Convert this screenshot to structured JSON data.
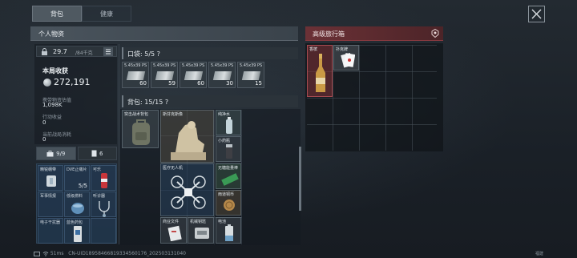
{
  "tabs": [
    {
      "label": "背包",
      "active": true
    },
    {
      "label": "健康",
      "active": false
    }
  ],
  "left_panel": {
    "title": "个人物资",
    "weight": {
      "value": "29.7",
      "max": "/84千克"
    },
    "income_label": "本局收获",
    "income_value": "272,191",
    "carried_value_label": "携带物资估值",
    "carried_value": "1,098K",
    "action_income_label": "行动收益",
    "action_income": "0",
    "loss_label": "当前战局消耗",
    "loss": "0",
    "subtabs": [
      {
        "label": "9/9",
        "icon": "medkit-icon"
      },
      {
        "label": "6",
        "icon": "document-icon"
      }
    ],
    "quick_items": [
      {
        "name": "精锐绷带",
        "count": ""
      },
      {
        "name": "DVE止痛片",
        "count": "5/5"
      },
      {
        "name": "可乐",
        "count": ""
      },
      {
        "name": "军事情报",
        "count": ""
      },
      {
        "name": "低级燃料",
        "count": ""
      },
      {
        "name": "听诊器",
        "count": ""
      },
      {
        "name": "电子干扰器",
        "count": ""
      },
      {
        "name": "蓝色药包",
        "count": ""
      },
      {
        "name": "",
        "count": ""
      }
    ]
  },
  "pocket": {
    "title": "口袋: 5/5 ?",
    "ammo": [
      {
        "name": "5.45x39 PS",
        "count": "60"
      },
      {
        "name": "5.45x39 PS",
        "count": "59"
      },
      {
        "name": "5.45x39 PS",
        "count": "60"
      },
      {
        "name": "5.45x39 PS",
        "count": "30"
      },
      {
        "name": "5.45x39 PS",
        "count": "15"
      }
    ]
  },
  "bag": {
    "title": "背包: 15/15 ?",
    "items": [
      {
        "name": "突击战术背包"
      },
      {
        "name": "斯芬克斯像"
      },
      {
        "name": "纯净水"
      },
      {
        "name": "小药瓶"
      },
      {
        "name": "医疗无人机"
      },
      {
        "name": "无糖能量棒"
      },
      {
        "name": "雨道铜币"
      },
      {
        "name": "商业文件"
      },
      {
        "name": "机械钥匙"
      },
      {
        "name": "电池"
      }
    ]
  },
  "right_panel": {
    "title": "高级旅行箱",
    "items": [
      {
        "name": "香槟"
      },
      {
        "name": "扑克牌"
      }
    ]
  },
  "footer": {
    "ping": "51ms",
    "uid": "CN-UID18958466819334560176_202503131040",
    "corner": "福建"
  }
}
